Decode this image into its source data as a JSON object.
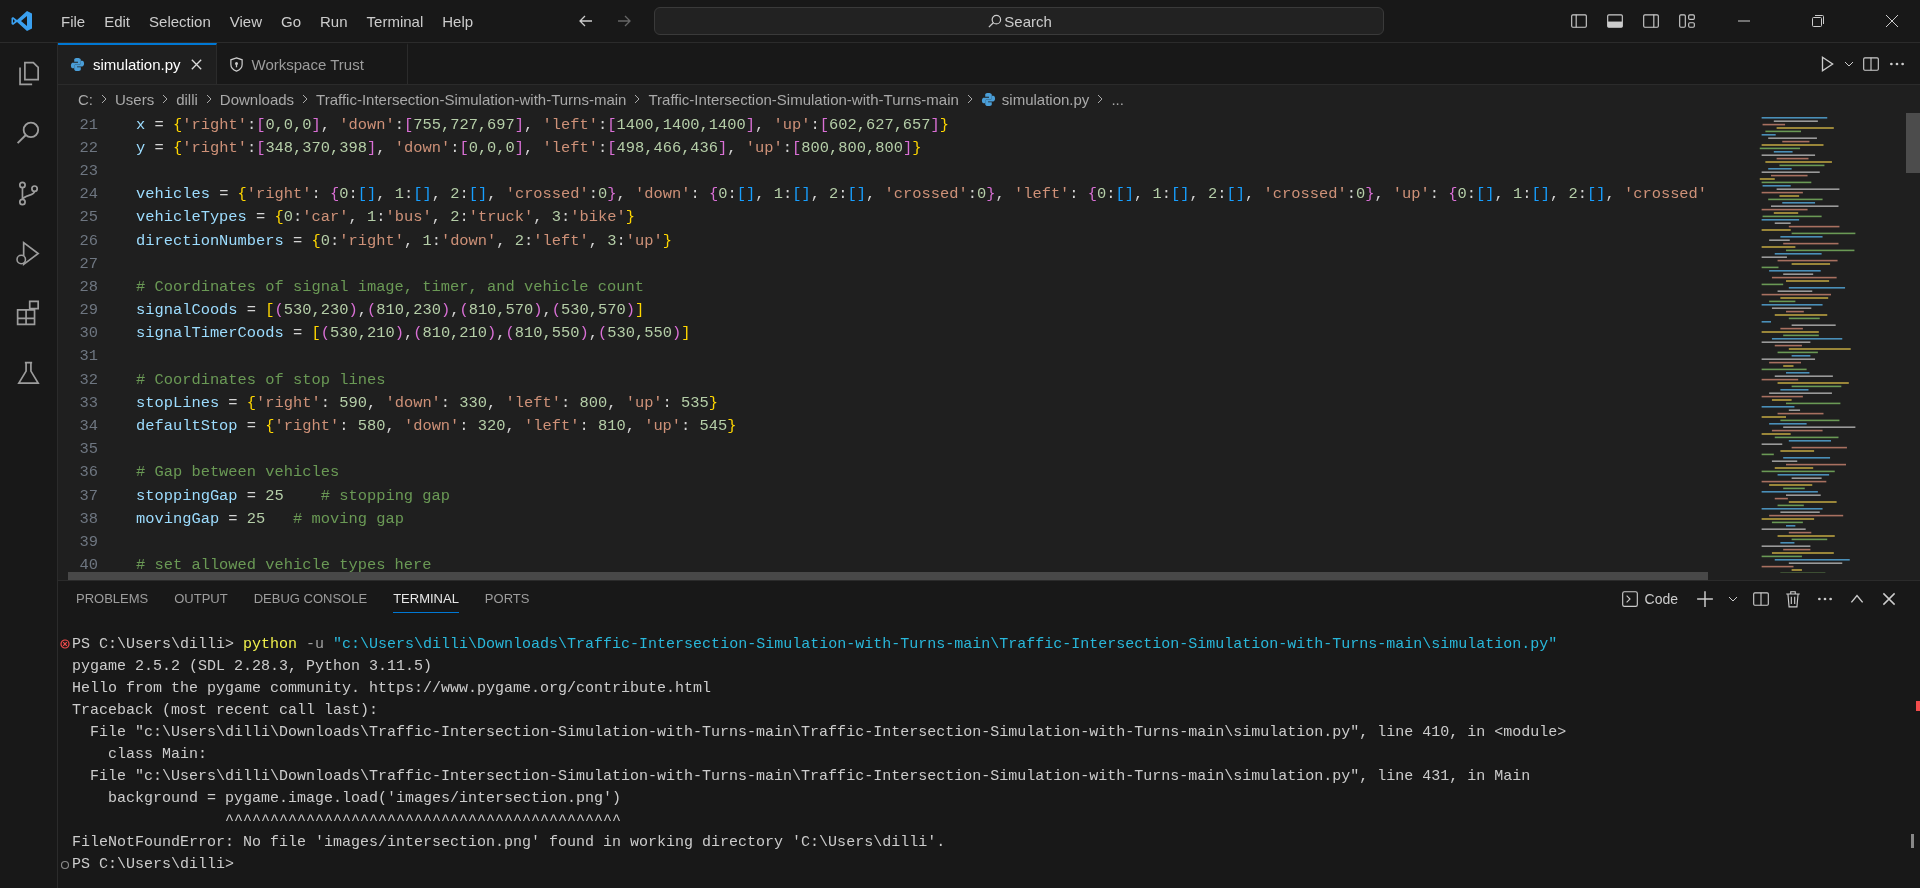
{
  "title_bar": {
    "menu": [
      "File",
      "Edit",
      "Selection",
      "View",
      "Go",
      "Run",
      "Terminal",
      "Help"
    ],
    "search": {
      "placeholder": "Search"
    }
  },
  "activity_bar": [
    {
      "kind": "files"
    },
    {
      "kind": "search"
    },
    {
      "kind": "source-control"
    },
    {
      "kind": "run-debug"
    },
    {
      "kind": "extensions"
    },
    {
      "kind": "testing"
    }
  ],
  "tabs": [
    {
      "label": "simulation.py",
      "kind": "python",
      "selected": true
    },
    {
      "label": "Workspace Trust",
      "kind": "shield",
      "selected": false
    }
  ],
  "breadcrumb": [
    {
      "label": "C:",
      "kind": "folder"
    },
    {
      "label": "Users",
      "kind": "folder"
    },
    {
      "label": "dilli",
      "kind": "folder"
    },
    {
      "label": "Downloads",
      "kind": "folder"
    },
    {
      "label": "Traffic-Intersection-Simulation-with-Turns-main",
      "kind": "folder"
    },
    {
      "label": "Traffic-Intersection-Simulation-with-Turns-main",
      "kind": "folder"
    },
    {
      "label": "simulation.py",
      "kind": "python"
    },
    {
      "label": "...",
      "kind": "more"
    }
  ],
  "editor": {
    "lines": [
      {
        "number": "21",
        "tokens": [
          {
            "kind": "v",
            "text": "x"
          },
          {
            "kind": "o",
            "text": " = "
          },
          {
            "kind": "b1",
            "text": "{"
          },
          {
            "kind": "s",
            "text": "'right'"
          },
          {
            "kind": "o",
            "text": ":"
          },
          {
            "kind": "b2",
            "text": "["
          },
          {
            "kind": "n",
            "text": "0,0,0"
          },
          {
            "kind": "b2",
            "text": "]"
          },
          {
            "kind": "o",
            "text": ", "
          },
          {
            "kind": "s",
            "text": "'down'"
          },
          {
            "kind": "o",
            "text": ":"
          },
          {
            "kind": "b2",
            "text": "["
          },
          {
            "kind": "n",
            "text": "755,727,697"
          },
          {
            "kind": "b2",
            "text": "]"
          },
          {
            "kind": "o",
            "text": ", "
          },
          {
            "kind": "s",
            "text": "'left'"
          },
          {
            "kind": "o",
            "text": ":"
          },
          {
            "kind": "b2",
            "text": "["
          },
          {
            "kind": "n",
            "text": "1400,1400,1400"
          },
          {
            "kind": "b2",
            "text": "]"
          },
          {
            "kind": "o",
            "text": ", "
          },
          {
            "kind": "s",
            "text": "'up'"
          },
          {
            "kind": "o",
            "text": ":"
          },
          {
            "kind": "b2",
            "text": "["
          },
          {
            "kind": "n",
            "text": "602,627,657"
          },
          {
            "kind": "b2",
            "text": "]"
          },
          {
            "kind": "b1",
            "text": "}"
          }
        ]
      },
      {
        "number": "22",
        "tokens": [
          {
            "kind": "v",
            "text": "y"
          },
          {
            "kind": "o",
            "text": " = "
          },
          {
            "kind": "b1",
            "text": "{"
          },
          {
            "kind": "s",
            "text": "'right'"
          },
          {
            "kind": "o",
            "text": ":"
          },
          {
            "kind": "b2",
            "text": "["
          },
          {
            "kind": "n",
            "text": "348,370,398"
          },
          {
            "kind": "b2",
            "text": "]"
          },
          {
            "kind": "o",
            "text": ", "
          },
          {
            "kind": "s",
            "text": "'down'"
          },
          {
            "kind": "o",
            "text": ":"
          },
          {
            "kind": "b2",
            "text": "["
          },
          {
            "kind": "n",
            "text": "0,0,0"
          },
          {
            "kind": "b2",
            "text": "]"
          },
          {
            "kind": "o",
            "text": ", "
          },
          {
            "kind": "s",
            "text": "'left'"
          },
          {
            "kind": "o",
            "text": ":"
          },
          {
            "kind": "b2",
            "text": "["
          },
          {
            "kind": "n",
            "text": "498,466,436"
          },
          {
            "kind": "b2",
            "text": "]"
          },
          {
            "kind": "o",
            "text": ", "
          },
          {
            "kind": "s",
            "text": "'up'"
          },
          {
            "kind": "o",
            "text": ":"
          },
          {
            "kind": "b2",
            "text": "["
          },
          {
            "kind": "n",
            "text": "800,800,800"
          },
          {
            "kind": "b2",
            "text": "]"
          },
          {
            "kind": "b1",
            "text": "}"
          }
        ]
      },
      {
        "number": "23"
      },
      {
        "number": "24",
        "tokens": [
          {
            "kind": "v",
            "text": "vehicles"
          },
          {
            "kind": "o",
            "text": " = "
          },
          {
            "kind": "b1",
            "text": "{"
          },
          {
            "kind": "s",
            "text": "'right'"
          },
          {
            "kind": "o",
            "text": ": "
          },
          {
            "kind": "b2",
            "text": "{"
          },
          {
            "kind": "n",
            "text": "0"
          },
          {
            "kind": "o",
            "text": ":"
          },
          {
            "kind": "b3",
            "text": "[]"
          },
          {
            "kind": "o",
            "text": ", "
          },
          {
            "kind": "n",
            "text": "1"
          },
          {
            "kind": "o",
            "text": ":"
          },
          {
            "kind": "b3",
            "text": "[]"
          },
          {
            "kind": "o",
            "text": ", "
          },
          {
            "kind": "n",
            "text": "2"
          },
          {
            "kind": "o",
            "text": ":"
          },
          {
            "kind": "b3",
            "text": "[]"
          },
          {
            "kind": "o",
            "text": ", "
          },
          {
            "kind": "s",
            "text": "'crossed'"
          },
          {
            "kind": "o",
            "text": ":"
          },
          {
            "kind": "n",
            "text": "0"
          },
          {
            "kind": "b2",
            "text": "}"
          },
          {
            "kind": "o",
            "text": ", "
          },
          {
            "kind": "s",
            "text": "'down'"
          },
          {
            "kind": "o",
            "text": ": "
          },
          {
            "kind": "b2",
            "text": "{"
          },
          {
            "kind": "n",
            "text": "0"
          },
          {
            "kind": "o",
            "text": ":"
          },
          {
            "kind": "b3",
            "text": "[]"
          },
          {
            "kind": "o",
            "text": ", "
          },
          {
            "kind": "n",
            "text": "1"
          },
          {
            "kind": "o",
            "text": ":"
          },
          {
            "kind": "b3",
            "text": "[]"
          },
          {
            "kind": "o",
            "text": ", "
          },
          {
            "kind": "n",
            "text": "2"
          },
          {
            "kind": "o",
            "text": ":"
          },
          {
            "kind": "b3",
            "text": "[]"
          },
          {
            "kind": "o",
            "text": ", "
          },
          {
            "kind": "s",
            "text": "'crossed'"
          },
          {
            "kind": "o",
            "text": ":"
          },
          {
            "kind": "n",
            "text": "0"
          },
          {
            "kind": "b2",
            "text": "}"
          },
          {
            "kind": "o",
            "text": ", "
          },
          {
            "kind": "s",
            "text": "'left'"
          },
          {
            "kind": "o",
            "text": ": "
          },
          {
            "kind": "b2",
            "text": "{"
          },
          {
            "kind": "n",
            "text": "0"
          },
          {
            "kind": "o",
            "text": ":"
          },
          {
            "kind": "b3",
            "text": "[]"
          },
          {
            "kind": "o",
            "text": ", "
          },
          {
            "kind": "n",
            "text": "1"
          },
          {
            "kind": "o",
            "text": ":"
          },
          {
            "kind": "b3",
            "text": "[]"
          },
          {
            "kind": "o",
            "text": ", "
          },
          {
            "kind": "n",
            "text": "2"
          },
          {
            "kind": "o",
            "text": ":"
          },
          {
            "kind": "b3",
            "text": "[]"
          },
          {
            "kind": "o",
            "text": ", "
          },
          {
            "kind": "s",
            "text": "'crossed'"
          },
          {
            "kind": "o",
            "text": ":"
          },
          {
            "kind": "n",
            "text": "0"
          },
          {
            "kind": "b2",
            "text": "}"
          },
          {
            "kind": "o",
            "text": ", "
          },
          {
            "kind": "s",
            "text": "'up'"
          },
          {
            "kind": "o",
            "text": ": "
          },
          {
            "kind": "b2",
            "text": "{"
          },
          {
            "kind": "n",
            "text": "0"
          },
          {
            "kind": "o",
            "text": ":"
          },
          {
            "kind": "b3",
            "text": "[]"
          },
          {
            "kind": "o",
            "text": ", "
          },
          {
            "kind": "n",
            "text": "1"
          },
          {
            "kind": "o",
            "text": ":"
          },
          {
            "kind": "b3",
            "text": "[]"
          },
          {
            "kind": "o",
            "text": ", "
          },
          {
            "kind": "n",
            "text": "2"
          },
          {
            "kind": "o",
            "text": ":"
          },
          {
            "kind": "b3",
            "text": "[]"
          },
          {
            "kind": "o",
            "text": ", "
          },
          {
            "kind": "s",
            "text": "'crossed'"
          }
        ]
      },
      {
        "number": "25",
        "tokens": [
          {
            "kind": "v",
            "text": "vehicleTypes"
          },
          {
            "kind": "o",
            "text": " = "
          },
          {
            "kind": "b1",
            "text": "{"
          },
          {
            "kind": "n",
            "text": "0"
          },
          {
            "kind": "o",
            "text": ":"
          },
          {
            "kind": "s",
            "text": "'car'"
          },
          {
            "kind": "o",
            "text": ", "
          },
          {
            "kind": "n",
            "text": "1"
          },
          {
            "kind": "o",
            "text": ":"
          },
          {
            "kind": "s",
            "text": "'bus'"
          },
          {
            "kind": "o",
            "text": ", "
          },
          {
            "kind": "n",
            "text": "2"
          },
          {
            "kind": "o",
            "text": ":"
          },
          {
            "kind": "s",
            "text": "'truck'"
          },
          {
            "kind": "o",
            "text": ", "
          },
          {
            "kind": "n",
            "text": "3"
          },
          {
            "kind": "o",
            "text": ":"
          },
          {
            "kind": "s",
            "text": "'bike'"
          },
          {
            "kind": "b1",
            "text": "}"
          }
        ]
      },
      {
        "number": "26",
        "tokens": [
          {
            "kind": "v",
            "text": "directionNumbers"
          },
          {
            "kind": "o",
            "text": " = "
          },
          {
            "kind": "b1",
            "text": "{"
          },
          {
            "kind": "n",
            "text": "0"
          },
          {
            "kind": "o",
            "text": ":"
          },
          {
            "kind": "s",
            "text": "'right'"
          },
          {
            "kind": "o",
            "text": ", "
          },
          {
            "kind": "n",
            "text": "1"
          },
          {
            "kind": "o",
            "text": ":"
          },
          {
            "kind": "s",
            "text": "'down'"
          },
          {
            "kind": "o",
            "text": ", "
          },
          {
            "kind": "n",
            "text": "2"
          },
          {
            "kind": "o",
            "text": ":"
          },
          {
            "kind": "s",
            "text": "'left'"
          },
          {
            "kind": "o",
            "text": ", "
          },
          {
            "kind": "n",
            "text": "3"
          },
          {
            "kind": "o",
            "text": ":"
          },
          {
            "kind": "s",
            "text": "'up'"
          },
          {
            "kind": "b1",
            "text": "}"
          }
        ]
      },
      {
        "number": "27"
      },
      {
        "number": "28",
        "tokens": [
          {
            "kind": "c",
            "text": "# Coordinates of signal image, timer, and vehicle count"
          }
        ]
      },
      {
        "number": "29",
        "tokens": [
          {
            "kind": "v",
            "text": "signalCoods"
          },
          {
            "kind": "o",
            "text": " = "
          },
          {
            "kind": "b1",
            "text": "["
          },
          {
            "kind": "b2",
            "text": "("
          },
          {
            "kind": "n",
            "text": "530,230"
          },
          {
            "kind": "b2",
            "text": ")"
          },
          {
            "kind": "o",
            "text": ","
          },
          {
            "kind": "b2",
            "text": "("
          },
          {
            "kind": "n",
            "text": "810,230"
          },
          {
            "kind": "b2",
            "text": ")"
          },
          {
            "kind": "o",
            "text": ","
          },
          {
            "kind": "b2",
            "text": "("
          },
          {
            "kind": "n",
            "text": "810,570"
          },
          {
            "kind": "b2",
            "text": ")"
          },
          {
            "kind": "o",
            "text": ","
          },
          {
            "kind": "b2",
            "text": "("
          },
          {
            "kind": "n",
            "text": "530,570"
          },
          {
            "kind": "b2",
            "text": ")"
          },
          {
            "kind": "b1",
            "text": "]"
          }
        ]
      },
      {
        "number": "30",
        "tokens": [
          {
            "kind": "v",
            "text": "signalTimerCoods"
          },
          {
            "kind": "o",
            "text": " = "
          },
          {
            "kind": "b1",
            "text": "["
          },
          {
            "kind": "b2",
            "text": "("
          },
          {
            "kind": "n",
            "text": "530,210"
          },
          {
            "kind": "b2",
            "text": ")"
          },
          {
            "kind": "o",
            "text": ","
          },
          {
            "kind": "b2",
            "text": "("
          },
          {
            "kind": "n",
            "text": "810,210"
          },
          {
            "kind": "b2",
            "text": ")"
          },
          {
            "kind": "o",
            "text": ","
          },
          {
            "kind": "b2",
            "text": "("
          },
          {
            "kind": "n",
            "text": "810,550"
          },
          {
            "kind": "b2",
            "text": ")"
          },
          {
            "kind": "o",
            "text": ","
          },
          {
            "kind": "b2",
            "text": "("
          },
          {
            "kind": "n",
            "text": "530,550"
          },
          {
            "kind": "b2",
            "text": ")"
          },
          {
            "kind": "b1",
            "text": "]"
          }
        ]
      },
      {
        "number": "31"
      },
      {
        "number": "32",
        "tokens": [
          {
            "kind": "c",
            "text": "# Coordinates of stop lines"
          }
        ]
      },
      {
        "number": "33",
        "tokens": [
          {
            "kind": "v",
            "text": "stopLines"
          },
          {
            "kind": "o",
            "text": " = "
          },
          {
            "kind": "b1",
            "text": "{"
          },
          {
            "kind": "s",
            "text": "'right'"
          },
          {
            "kind": "o",
            "text": ": "
          },
          {
            "kind": "n",
            "text": "590"
          },
          {
            "kind": "o",
            "text": ", "
          },
          {
            "kind": "s",
            "text": "'down'"
          },
          {
            "kind": "o",
            "text": ": "
          },
          {
            "kind": "n",
            "text": "330"
          },
          {
            "kind": "o",
            "text": ", "
          },
          {
            "kind": "s",
            "text": "'left'"
          },
          {
            "kind": "o",
            "text": ": "
          },
          {
            "kind": "n",
            "text": "800"
          },
          {
            "kind": "o",
            "text": ", "
          },
          {
            "kind": "s",
            "text": "'up'"
          },
          {
            "kind": "o",
            "text": ": "
          },
          {
            "kind": "n",
            "text": "535"
          },
          {
            "kind": "b1",
            "text": "}"
          }
        ]
      },
      {
        "number": "34",
        "tokens": [
          {
            "kind": "v",
            "text": "defaultStop"
          },
          {
            "kind": "o",
            "text": " = "
          },
          {
            "kind": "b1",
            "text": "{"
          },
          {
            "kind": "s",
            "text": "'right'"
          },
          {
            "kind": "o",
            "text": ": "
          },
          {
            "kind": "n",
            "text": "580"
          },
          {
            "kind": "o",
            "text": ", "
          },
          {
            "kind": "s",
            "text": "'down'"
          },
          {
            "kind": "o",
            "text": ": "
          },
          {
            "kind": "n",
            "text": "320"
          },
          {
            "kind": "o",
            "text": ", "
          },
          {
            "kind": "s",
            "text": "'left'"
          },
          {
            "kind": "o",
            "text": ": "
          },
          {
            "kind": "n",
            "text": "810"
          },
          {
            "kind": "o",
            "text": ", "
          },
          {
            "kind": "s",
            "text": "'up'"
          },
          {
            "kind": "o",
            "text": ": "
          },
          {
            "kind": "n",
            "text": "545"
          },
          {
            "kind": "b1",
            "text": "}"
          }
        ]
      },
      {
        "number": "35"
      },
      {
        "number": "36",
        "tokens": [
          {
            "kind": "c",
            "text": "# Gap between vehicles"
          }
        ]
      },
      {
        "number": "37",
        "tokens": [
          {
            "kind": "v",
            "text": "stoppingGap"
          },
          {
            "kind": "o",
            "text": " = "
          },
          {
            "kind": "n",
            "text": "25    "
          },
          {
            "kind": "c",
            "text": "# stopping gap"
          }
        ]
      },
      {
        "number": "38",
        "tokens": [
          {
            "kind": "v",
            "text": "movingGap"
          },
          {
            "kind": "o",
            "text": " = "
          },
          {
            "kind": "n",
            "text": "25   "
          },
          {
            "kind": "c",
            "text": "# moving gap"
          }
        ]
      },
      {
        "number": "39"
      },
      {
        "number": "40",
        "tokens": [
          {
            "kind": "c",
            "text": "# set allowed vehicle types here"
          }
        ]
      }
    ]
  },
  "panel": {
    "tabs": [
      {
        "label": "PROBLEMS",
        "selected": false
      },
      {
        "label": "OUTPUT",
        "selected": false
      },
      {
        "label": "DEBUG CONSOLE",
        "selected": false
      },
      {
        "label": "TERMINAL",
        "selected": true
      },
      {
        "label": "PORTS",
        "selected": false
      }
    ],
    "terminal_name": "Code",
    "terminal": [
      {
        "kind": "failed-command",
        "tokens": [
          {
            "kind": "p",
            "text": "PS C:\\Users\\dilli> "
          },
          {
            "kind": "y",
            "text": "python"
          },
          {
            "kind": "g",
            "text": " -u "
          },
          {
            "kind": "b",
            "text": "\"c:\\Users\\dilli\\Downloads\\Traffic-Intersection-Simulation-with-Turns-main\\Traffic-Intersection-Simulation-with-Turns-main\\simulation.py\""
          }
        ]
      },
      {
        "kind": "output",
        "tokens": [
          {
            "kind": "p",
            "text": "pygame 2.5.2 (SDL 2.28.3, Python 3.11.5)"
          }
        ]
      },
      {
        "kind": "output",
        "tokens": [
          {
            "kind": "p",
            "text": "Hello from the pygame community. https://www.pygame.org/contribute.html"
          }
        ]
      },
      {
        "kind": "output",
        "tokens": [
          {
            "kind": "p",
            "text": "Traceback (most recent call last):"
          }
        ]
      },
      {
        "kind": "output",
        "tokens": [
          {
            "kind": "p",
            "text": "  File \"c:\\Users\\dilli\\Downloads\\Traffic-Intersection-Simulation-with-Turns-main\\Traffic-Intersection-Simulation-with-Turns-main\\simulation.py\", line 410, in <module>"
          }
        ]
      },
      {
        "kind": "output",
        "tokens": [
          {
            "kind": "p",
            "text": "    class Main:"
          }
        ]
      },
      {
        "kind": "output",
        "tokens": [
          {
            "kind": "p",
            "text": "  File \"c:\\Users\\dilli\\Downloads\\Traffic-Intersection-Simulation-with-Turns-main\\Traffic-Intersection-Simulation-with-Turns-main\\simulation.py\", line 431, in Main"
          }
        ]
      },
      {
        "kind": "output",
        "tokens": [
          {
            "kind": "p",
            "text": "    background = pygame.image.load('images/intersection.png')"
          }
        ]
      },
      {
        "kind": "output",
        "tokens": [
          {
            "kind": "p",
            "text": "                 ^^^^^^^^^^^^^^^^^^^^^^^^^^^^^^^^^^^^^^^^^^^^"
          }
        ]
      },
      {
        "kind": "output",
        "tokens": [
          {
            "kind": "p",
            "text": "FileNotFoundError: No file 'images/intersection.png' found in working directory 'C:\\Users\\dilli'."
          }
        ]
      },
      {
        "kind": "prompt",
        "tokens": [
          {
            "kind": "p",
            "text": "PS C:\\Users\\dilli>"
          }
        ]
      }
    ]
  }
}
